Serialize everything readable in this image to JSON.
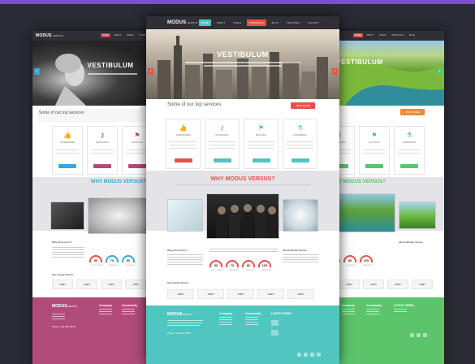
{
  "brand": {
    "name": "MODUS",
    "suffix": "VERSUS"
  },
  "nav": [
    "HOME",
    "ABOUT",
    "PAGES",
    "PORTFOLIO",
    "BLOG",
    "FEATURES",
    "CONTACT",
    "TOOLS"
  ],
  "hero": {
    "title": "VESTIBULUM"
  },
  "services": {
    "title": "Some of our top services",
    "button": "VIEW MORE"
  },
  "cards": [
    {
      "name": "SUPERMODEM",
      "icon": "thumb-up-icon"
    },
    {
      "name": "MAINTAINING",
      "icon": "key-icon"
    },
    {
      "name": "BLOGGING",
      "icon": "flag-icon"
    },
    {
      "name": "EXPERIENCE",
      "icon": "flask-icon"
    }
  ],
  "why": {
    "title": "WHY MODUS VERSUS?"
  },
  "skills": [
    {
      "value": "50",
      "label": "PHOTOGRAPHY"
    },
    {
      "value": "70",
      "label": "WEBDESIGN"
    },
    {
      "value": "80",
      "label": "BLOGGING"
    },
    {
      "value": "100",
      "label": "MARKETING"
    }
  ],
  "sections": {
    "why_choose": "Why Choose Us?",
    "about": "About Modus Versus",
    "clients": "Our Happy Clients"
  },
  "clients": [
    "JOBY",
    "JOBY",
    "JOBY",
    "JOBY",
    "JOBY"
  ],
  "footer": {
    "logo": "MODUS",
    "logo_suffix": "VERSUS",
    "columns": [
      "Company",
      "Community",
      "LATEST NEWS"
    ],
    "phone_label": "Phone:",
    "phone": "+01 234 5678"
  },
  "themes": {
    "left": "#b14c7a",
    "center": "#4fc6c0",
    "right": "#5cc46b",
    "accent": "#e8504b"
  }
}
